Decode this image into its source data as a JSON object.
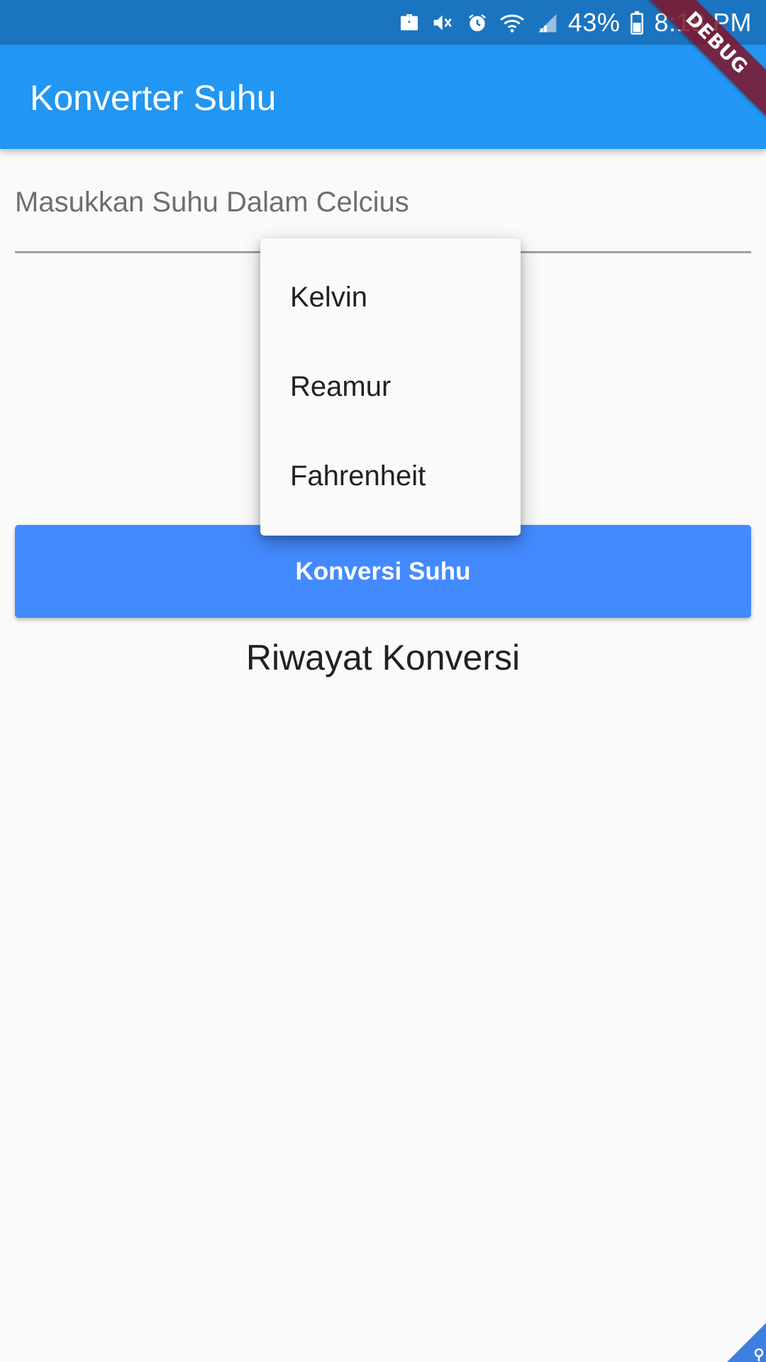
{
  "status_bar": {
    "battery_percent": "43%",
    "time": "8:18 PM",
    "icons": [
      "briefcase-icon",
      "mute-icon",
      "alarm-icon",
      "wifi-icon",
      "signal-icon",
      "battery-icon"
    ]
  },
  "app_bar": {
    "title": "Konverter Suhu",
    "background": "#2196f3"
  },
  "debug_banner": {
    "label": "DEBUG"
  },
  "input": {
    "placeholder": "Masukkan Suhu Dalam Celcius",
    "value": ""
  },
  "dropdown": {
    "options": [
      "Kelvin",
      "Reamur",
      "Fahrenheit"
    ]
  },
  "convert_button": {
    "label": "Konversi Suhu",
    "color": "#448aff"
  },
  "history": {
    "title": "Riwayat Konversi",
    "items": []
  }
}
